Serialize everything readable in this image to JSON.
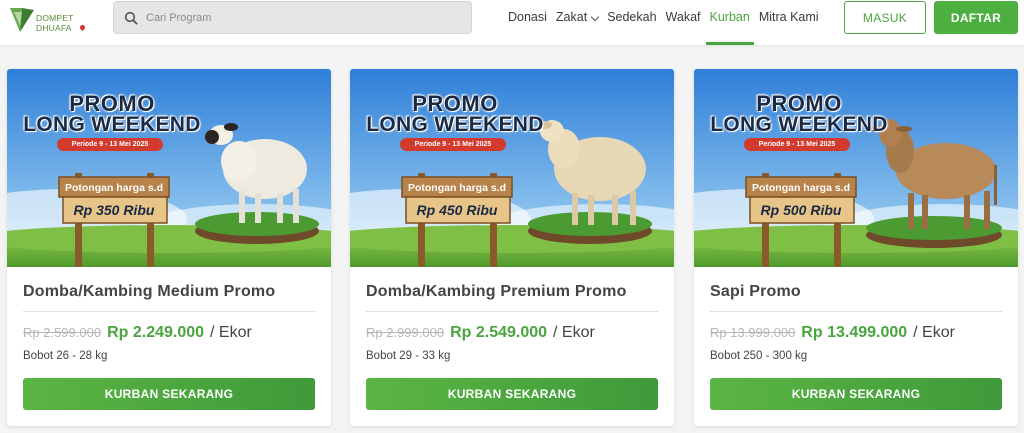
{
  "header": {
    "logo_line1": "DOMPET",
    "logo_line2": "DHUAFA",
    "search_placeholder": "Cari Program",
    "nav": [
      {
        "label": "Donasi"
      },
      {
        "label": "Zakat"
      },
      {
        "label": "Sedekah"
      },
      {
        "label": "Wakaf"
      },
      {
        "label": "Kurban"
      },
      {
        "label": "Mitra Kami"
      }
    ],
    "login_label": "MASUK",
    "register_label": "DAFTAR"
  },
  "products": [
    {
      "banner_title_1": "PROMO",
      "banner_title_2": "LONG WEEKEND",
      "banner_period": "Periode 9 - 13 Mei 2025",
      "banner_sign_top": "Potongan harga s.d",
      "banner_sign_price": "Rp 350 Ribu",
      "animal": "sheep",
      "title": "Domba/Kambing Medium Promo",
      "old_price": "Rp 2.599.000",
      "new_price": "Rp 2.249.000",
      "unit": "/ Ekor",
      "weight": "Bobot 26 - 28 kg",
      "cta": "KURBAN SEKARANG"
    },
    {
      "banner_title_1": "PROMO",
      "banner_title_2": "LONG WEEKEND",
      "banner_period": "Periode 9 - 13 Mei 2025",
      "banner_sign_top": "Potongan harga s.d",
      "banner_sign_price": "Rp 450 Ribu",
      "animal": "sheep",
      "title": "Domba/Kambing Premium Promo",
      "old_price": "Rp 2.999.000",
      "new_price": "Rp 2.549.000",
      "unit": "/ Ekor",
      "weight": "Bobot 29 - 33 kg",
      "cta": "KURBAN SEKARANG"
    },
    {
      "banner_title_1": "PROMO",
      "banner_title_2": "LONG WEEKEND",
      "banner_period": "Periode 9 - 13 Mei 2025",
      "banner_sign_top": "Potongan harga s.d",
      "banner_sign_price": "Rp 500 Ribu",
      "animal": "cow",
      "title": "Sapi Promo",
      "old_price": "Rp 13.999.000",
      "new_price": "Rp 13.499.000",
      "unit": "/ Ekor",
      "weight": "Bobot 250 - 300 kg",
      "cta": "KURBAN SEKARANG"
    }
  ],
  "colors": {
    "brand_green": "#4aa43f",
    "sky": "#3d8be0",
    "promo_red": "#d23a2e"
  }
}
